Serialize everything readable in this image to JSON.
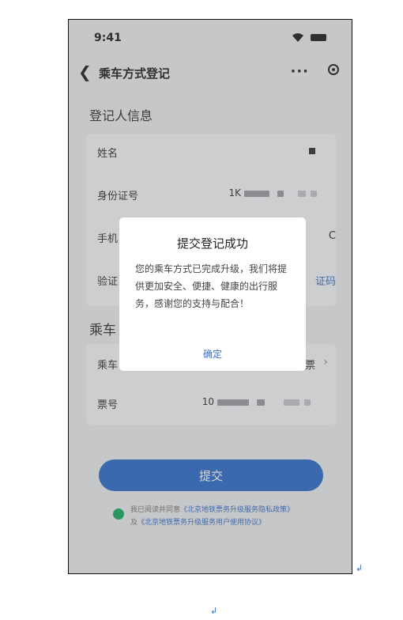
{
  "status_bar": {
    "time": "9:41"
  },
  "nav": {
    "title": "乘车方式登记"
  },
  "section1": {
    "title": "登记人信息"
  },
  "fields": {
    "name": {
      "label": "姓名"
    },
    "id": {
      "label": "身份证号",
      "value_prefix": "1K"
    },
    "phone": {
      "label": "手机",
      "edge": "C"
    },
    "code": {
      "label": "验证",
      "edge": "证码"
    }
  },
  "section2": {
    "title": "乘车"
  },
  "ride": {
    "mode": {
      "label": "乘车",
      "edge": "票"
    },
    "ticket": {
      "label": "票号",
      "value_prefix": "10"
    }
  },
  "submit": {
    "label": "提交"
  },
  "agreement": {
    "prefix": "我已阅读并同意",
    "link1": "《北京地铁票务升级服务隐私政策》",
    "and": "及",
    "link2": "《北京地铁票务升级服务用户使用协议》"
  },
  "dialog": {
    "title": "提交登记成功",
    "message": "您的乘车方式已完成升级，我们将提供更加安全、便捷、健康的出行服务，感谢您的支持与配合！",
    "ok": "确定"
  },
  "marks": {
    "symbol": "↲"
  },
  "colors": {
    "primary": "#2f6fc9",
    "check": "#1aad5f",
    "link": "#3b6fc6"
  }
}
